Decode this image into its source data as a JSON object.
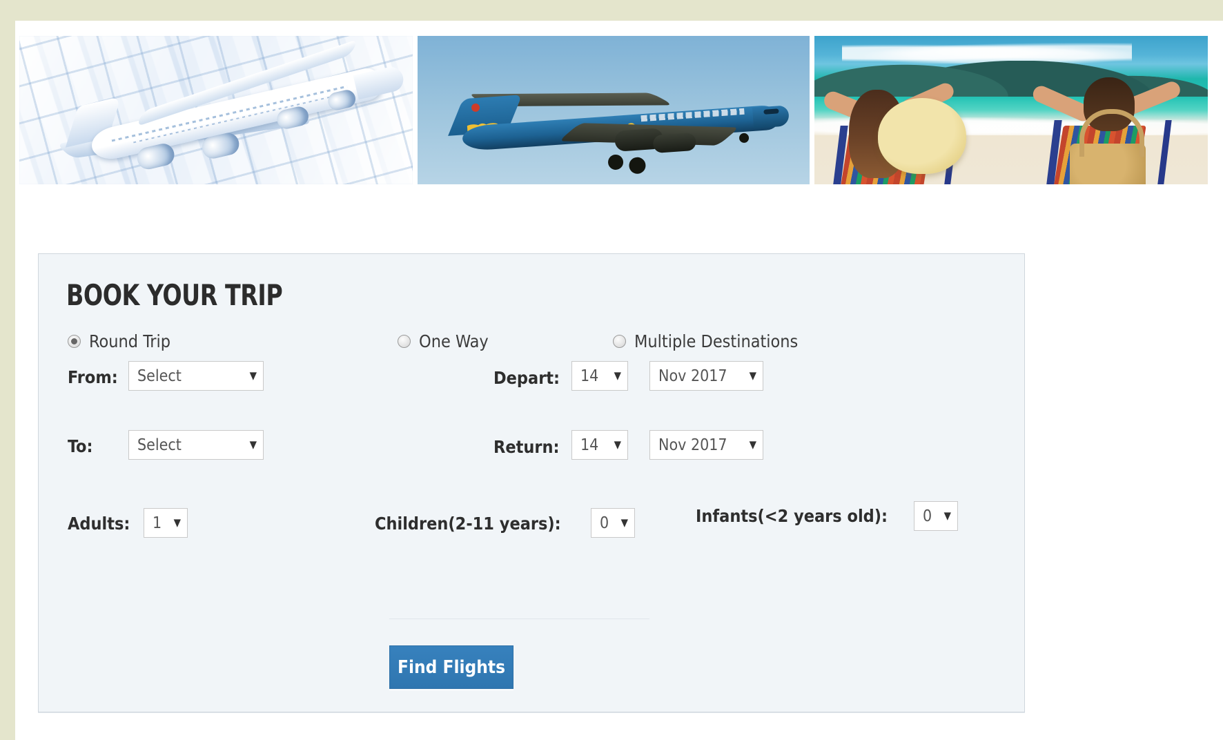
{
  "banners": [
    {
      "name": "model-airplane-on-keyboard",
      "alt": "Model airplane resting on a blue-tinted computer keyboard"
    },
    {
      "name": "vietnam-airlines-jet",
      "alt": "Blue Vietnam Airlines jet airliner flying in a clear sky"
    },
    {
      "name": "beach-couple-loungers",
      "alt": "Couple relaxing on striped beach chairs facing a turquoise sea"
    }
  ],
  "panel": {
    "title": "BOOK YOUR TRIP",
    "trip_types": [
      {
        "label": "Round Trip",
        "checked": true
      },
      {
        "label": "One Way",
        "checked": false
      },
      {
        "label": "Multiple Destinations",
        "checked": false
      }
    ],
    "fields": {
      "from_label": "From:",
      "from_value": "Select",
      "to_label": "To:",
      "to_value": "Select",
      "depart_label": "Depart:",
      "depart_day": "14",
      "depart_month": "Nov 2017",
      "return_label": "Return:",
      "return_day": "14",
      "return_month": "Nov 2017",
      "adults_label": "Adults:",
      "adults_value": "1",
      "children_label": "Children(2-11 years):",
      "children_value": "0",
      "infants_label": "Infants(<2 years old):",
      "infants_value": "0"
    },
    "submit_label": "Find Flights",
    "caret": "▼"
  },
  "colors": {
    "page_background": "#e4e5cc",
    "panel_background": "#f1f5f8",
    "panel_border": "#cfd6dd",
    "button_blue": "#3781bd",
    "title_text": "#2c2c2c"
  }
}
